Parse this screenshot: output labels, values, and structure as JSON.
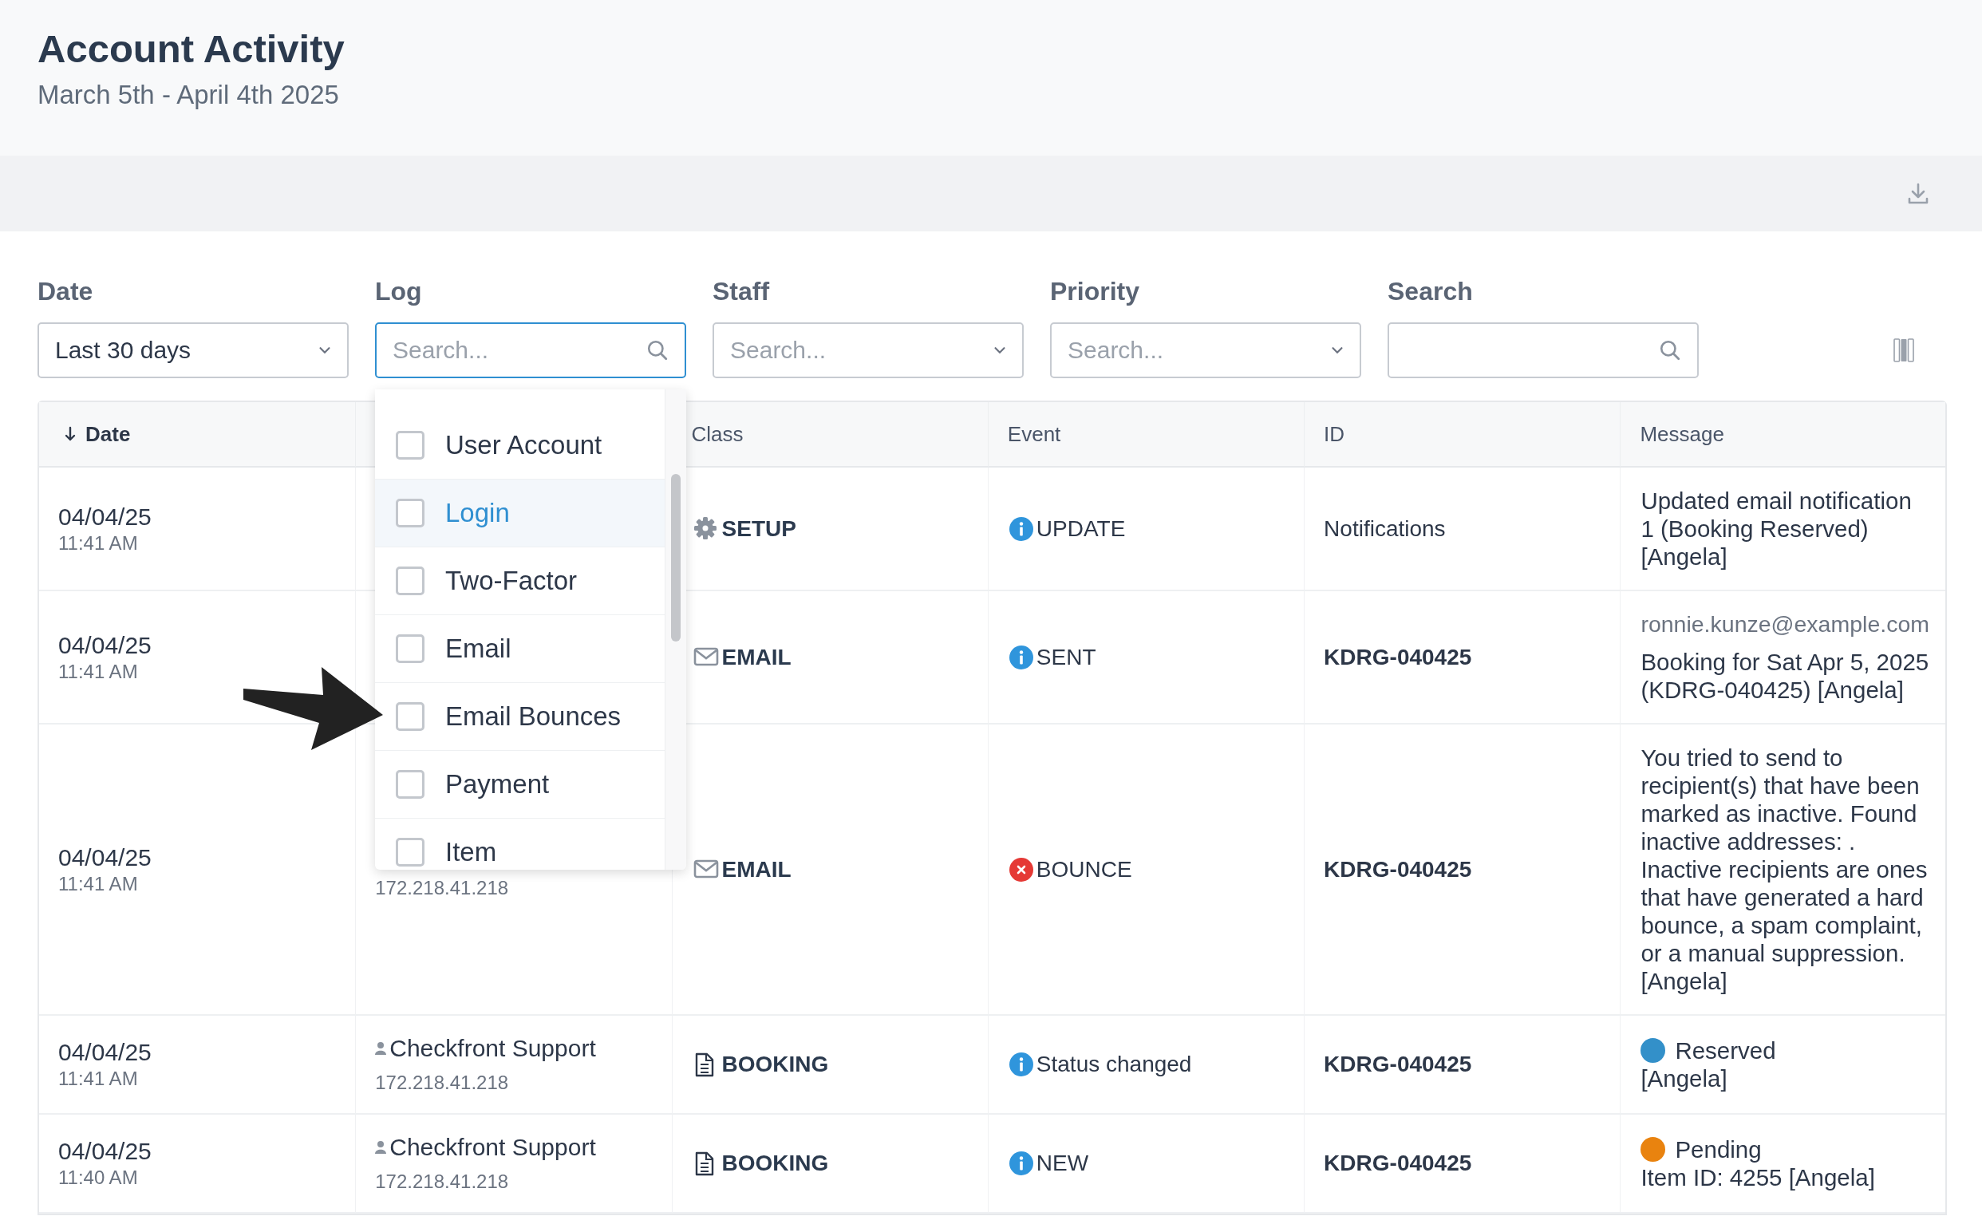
{
  "header": {
    "title": "Account Activity",
    "subtitle": "March 5th - April 4th 2025"
  },
  "filters": [
    {
      "label": "Date",
      "kind": "select",
      "value": "Last 30 days",
      "focused": false
    },
    {
      "label": "Log",
      "kind": "search",
      "placeholder": "Search...",
      "focused": true
    },
    {
      "label": "Staff",
      "kind": "select",
      "placeholder": "Search...",
      "focused": false
    },
    {
      "label": "Priority",
      "kind": "select",
      "placeholder": "Search...",
      "focused": false
    },
    {
      "label": "Search",
      "kind": "search",
      "focused": false
    }
  ],
  "log_dropdown": {
    "options": [
      {
        "label": "User Account",
        "checked": false,
        "highlighted": false
      },
      {
        "label": "Login",
        "checked": false,
        "highlighted": true
      },
      {
        "label": "Two-Factor",
        "checked": false,
        "highlighted": false
      },
      {
        "label": "Email",
        "checked": false,
        "highlighted": false
      },
      {
        "label": "Email Bounces",
        "checked": false,
        "highlighted": false
      },
      {
        "label": "Payment",
        "checked": false,
        "highlighted": false
      },
      {
        "label": "Item",
        "checked": false,
        "highlighted": false
      }
    ]
  },
  "table": {
    "columns": [
      {
        "label": "Date",
        "sorted": true
      },
      {
        "label": "Class",
        "sorted": false
      },
      {
        "label": "Event",
        "sorted": false
      },
      {
        "label": "ID",
        "sorted": false
      },
      {
        "label": "Message",
        "sorted": false
      }
    ],
    "rows": [
      {
        "date": "04/04/25",
        "time": "11:41 AM",
        "class": {
          "kind": "setup",
          "label": "SETUP"
        },
        "event": {
          "kind": "info",
          "label": "UPDATE"
        },
        "id": "Notifications",
        "id_bold": false,
        "message": {
          "text": "Updated email notification 1 (Booking Reserved) [Angela]"
        }
      },
      {
        "date": "04/04/25",
        "time": "11:41 AM",
        "class": {
          "kind": "email",
          "label": "EMAIL"
        },
        "event": {
          "kind": "info",
          "label": "SENT"
        },
        "id": "KDRG-040425",
        "id_bold": true,
        "message": {
          "email": "ronnie.kunze@example.com",
          "text": "Booking for Sat Apr 5, 2025 (KDRG-040425) [Angela]"
        }
      },
      {
        "date": "04/04/25",
        "time": "11:41 AM",
        "user": {
          "ip": "172.218.41.218"
        },
        "class": {
          "kind": "email",
          "label": "EMAIL"
        },
        "event": {
          "kind": "error",
          "label": "BOUNCE"
        },
        "id": "KDRG-040425",
        "id_bold": true,
        "message": {
          "text": "You tried to send to recipient(s) that have been marked as inactive. Found inactive addresses: . Inactive recipients are ones that have generated a hard bounce, a spam complaint, or a manual suppression. [Angela]"
        }
      },
      {
        "date": "04/04/25",
        "time": "11:41 AM",
        "user": {
          "name": "Checkfront Support",
          "ip": "172.218.41.218"
        },
        "class": {
          "kind": "booking",
          "label": "BOOKING"
        },
        "event": {
          "kind": "info",
          "label": "Status changed"
        },
        "id": "KDRG-040425",
        "id_bold": true,
        "message": {
          "status": {
            "label": "Reserved",
            "color": "#3390c9"
          },
          "text": "[Angela]"
        }
      },
      {
        "date": "04/04/25",
        "time": "11:40 AM",
        "user": {
          "name": "Checkfront Support",
          "ip": "172.218.41.218"
        },
        "class": {
          "kind": "booking",
          "label": "BOOKING"
        },
        "event": {
          "kind": "info",
          "label": "NEW"
        },
        "id": "KDRG-040425",
        "id_bold": true,
        "message": {
          "status": {
            "label": "Pending",
            "color": "#e9830f"
          },
          "text": "Item ID: 4255 [Angela]"
        }
      }
    ]
  }
}
